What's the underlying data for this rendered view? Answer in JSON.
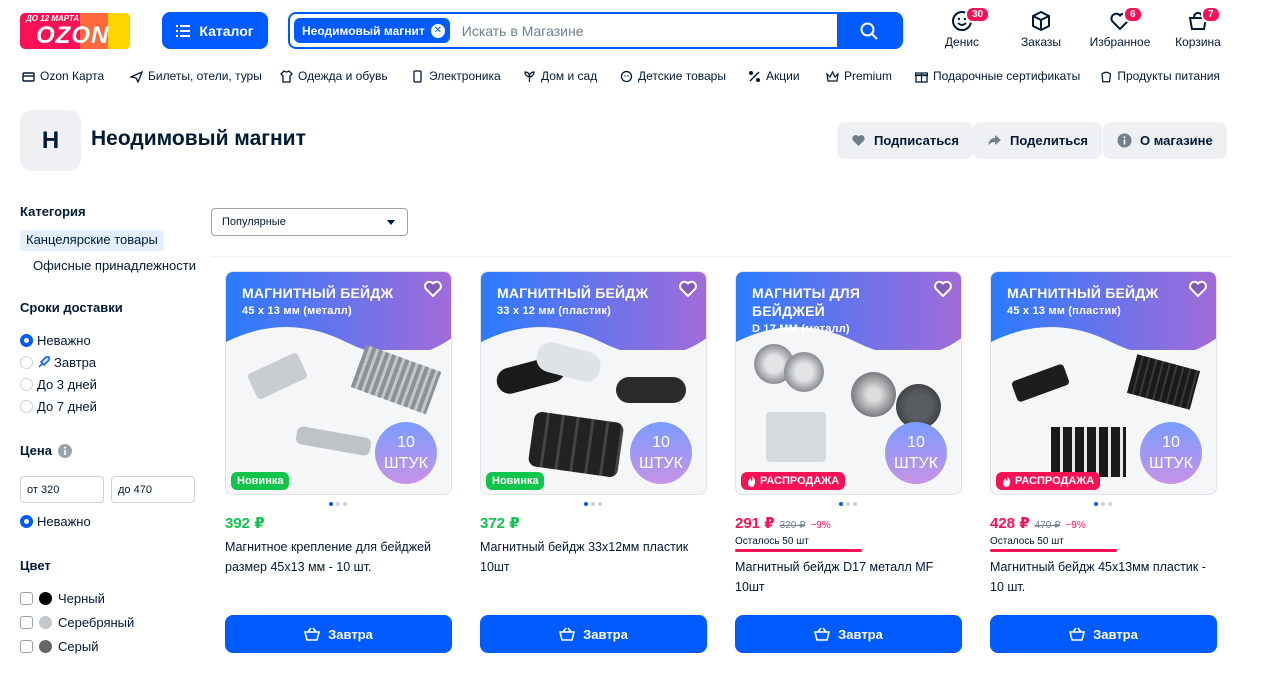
{
  "header": {
    "logo_tag": "ДО 12 МАРТА",
    "logo_text": "OZON",
    "catalog_label": "Каталог",
    "search_chip": "Неодимовый магнит",
    "search_placeholder": "Искать в Магазине",
    "user_label": "Денис",
    "user_badge": "30",
    "orders_label": "Заказы",
    "favorites_label": "Избранное",
    "favorites_badge": "6",
    "cart_label": "Корзина",
    "cart_badge": "7"
  },
  "nav": {
    "items": [
      "Ozon Карта",
      "Билеты, отели, туры",
      "Одежда и обувь",
      "Электроника",
      "Дом и сад",
      "Детские товары",
      "Акции",
      "Premium",
      "Подарочные сертификаты",
      "Продукты питания"
    ]
  },
  "shop": {
    "avatar_letter": "Н",
    "title": "Неодимовый магнит",
    "subscribe_label": "Подписаться",
    "share_label": "Поделиться",
    "about_label": "О магазине"
  },
  "filters": {
    "category_title": "Категория",
    "category_selected": "Канцелярские товары",
    "category_sub": "Офисные принадлежности",
    "delivery_title": "Сроки доставки",
    "delivery_options": [
      "Неважно",
      "Завтра",
      "До 3 дней",
      "До 7 дней"
    ],
    "price_title": "Цена",
    "price_from": "от 320",
    "price_to": "до 470",
    "price_any": "Неважно",
    "color_title": "Цвет",
    "colors": [
      {
        "label": "Черный",
        "hex": "#000000"
      },
      {
        "label": "Серебряный",
        "hex": "#c4c7cc"
      },
      {
        "label": "Серый",
        "hex": "#666666"
      }
    ]
  },
  "sort": {
    "selected": "Популярные"
  },
  "products": [
    {
      "banner_title": "МАГНИТНЫЙ БЕЙДЖ",
      "banner_sub": "45 х 13 мм (металл)",
      "pack_num": "10",
      "pack_unit": "ШТУК",
      "badge": "Новинка",
      "price": "392 ₽",
      "old_price": "",
      "discount": "",
      "stock": "",
      "name": "Магнитное крепление для бейджей размер 45х13 мм - 10 шт.",
      "buy_label": "Завтра"
    },
    {
      "banner_title": "МАГНИТНЫЙ БЕЙДЖ",
      "banner_sub": "33 х 12 мм (пластик)",
      "pack_num": "10",
      "pack_unit": "ШТУК",
      "badge": "Новинка",
      "price": "372 ₽",
      "old_price": "",
      "discount": "",
      "stock": "",
      "name": "Магнитный бейдж 33х12мм пластик 10шт",
      "buy_label": "Завтра"
    },
    {
      "banner_title": "МАГНИТЫ ДЛЯ БЕЙДЖЕЙ",
      "banner_sub": "D 17 ММ (металл)",
      "pack_num": "10",
      "pack_unit": "ШТУК",
      "badge": "РАСПРОДАЖА",
      "price": "291 ₽",
      "old_price": "320 ₽",
      "discount": "−9%",
      "stock": "Осталось 50 шт",
      "name": "Магнитный бейдж D17 металл MF 10шт",
      "buy_label": "Завтра"
    },
    {
      "banner_title": "МАГНИТНЫЙ БЕЙДЖ",
      "banner_sub": "45 х 13 мм (пластик)",
      "pack_num": "10",
      "pack_unit": "ШТУК",
      "badge": "РАСПРОДАЖА",
      "price": "428 ₽",
      "old_price": "470 ₽",
      "discount": "−9%",
      "stock": "Осталось 50 шт",
      "name": "Магнитный бейдж 45х13мм пластик - 10 шт.",
      "buy_label": "Завтра"
    }
  ],
  "colors": {
    "primary": "#005bff",
    "sale": "#f91155",
    "new": "#10c44c"
  }
}
